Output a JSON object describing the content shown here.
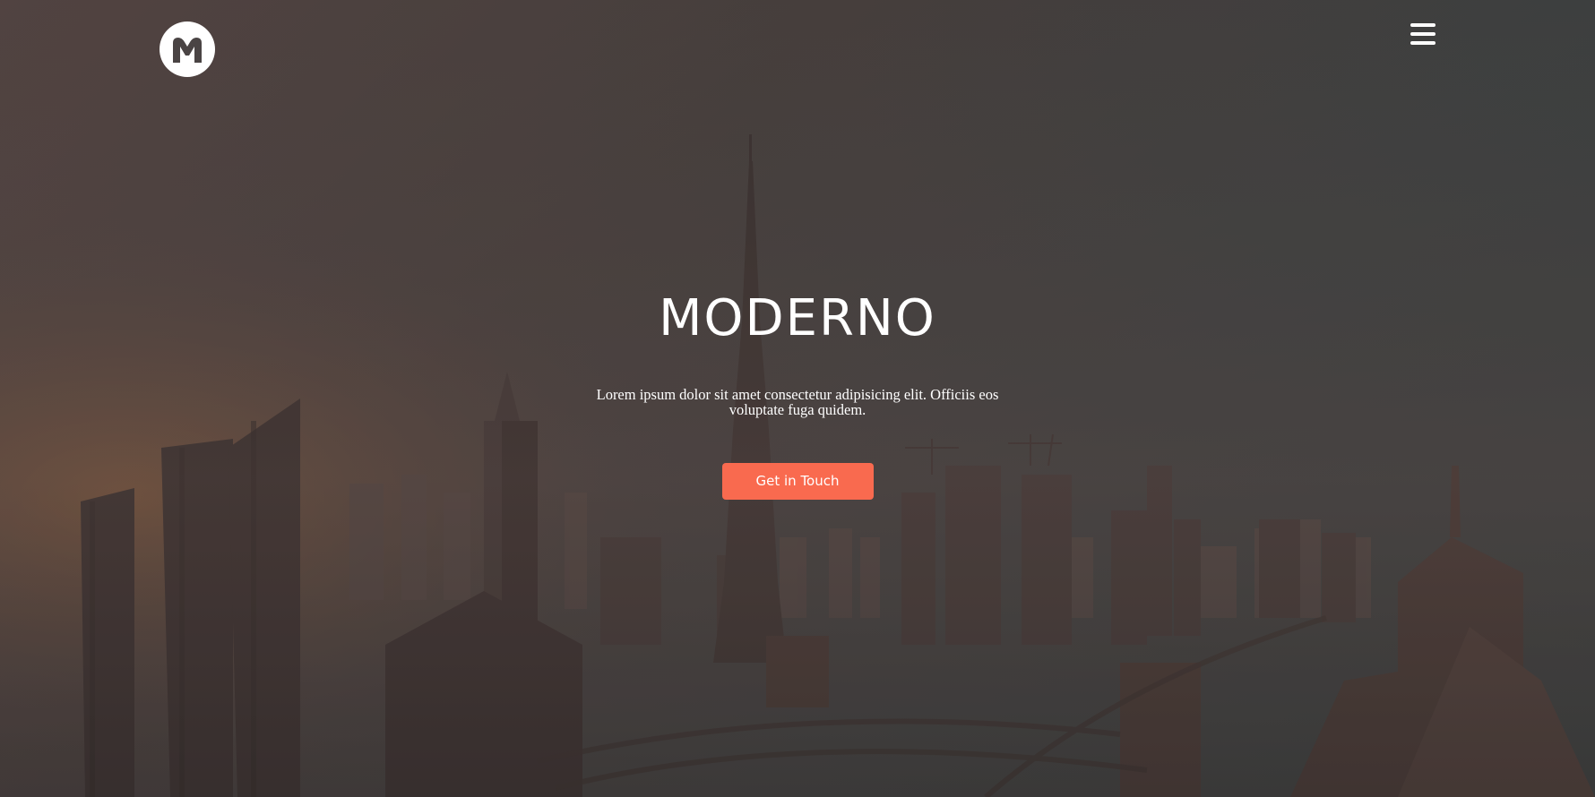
{
  "header": {
    "logo_letter": "M",
    "menu_icon": "hamburger-menu-icon"
  },
  "hero": {
    "title": "MODERNO",
    "text": "Lorem ipsum dolor sit amet consectetur adipisicing elit. Officiis eos voluptate fuga quidem.",
    "cta_label": "Get in Touch"
  },
  "colors": {
    "accent": "#f96a4f",
    "text": "#ffffff",
    "background": "#4a4444"
  }
}
